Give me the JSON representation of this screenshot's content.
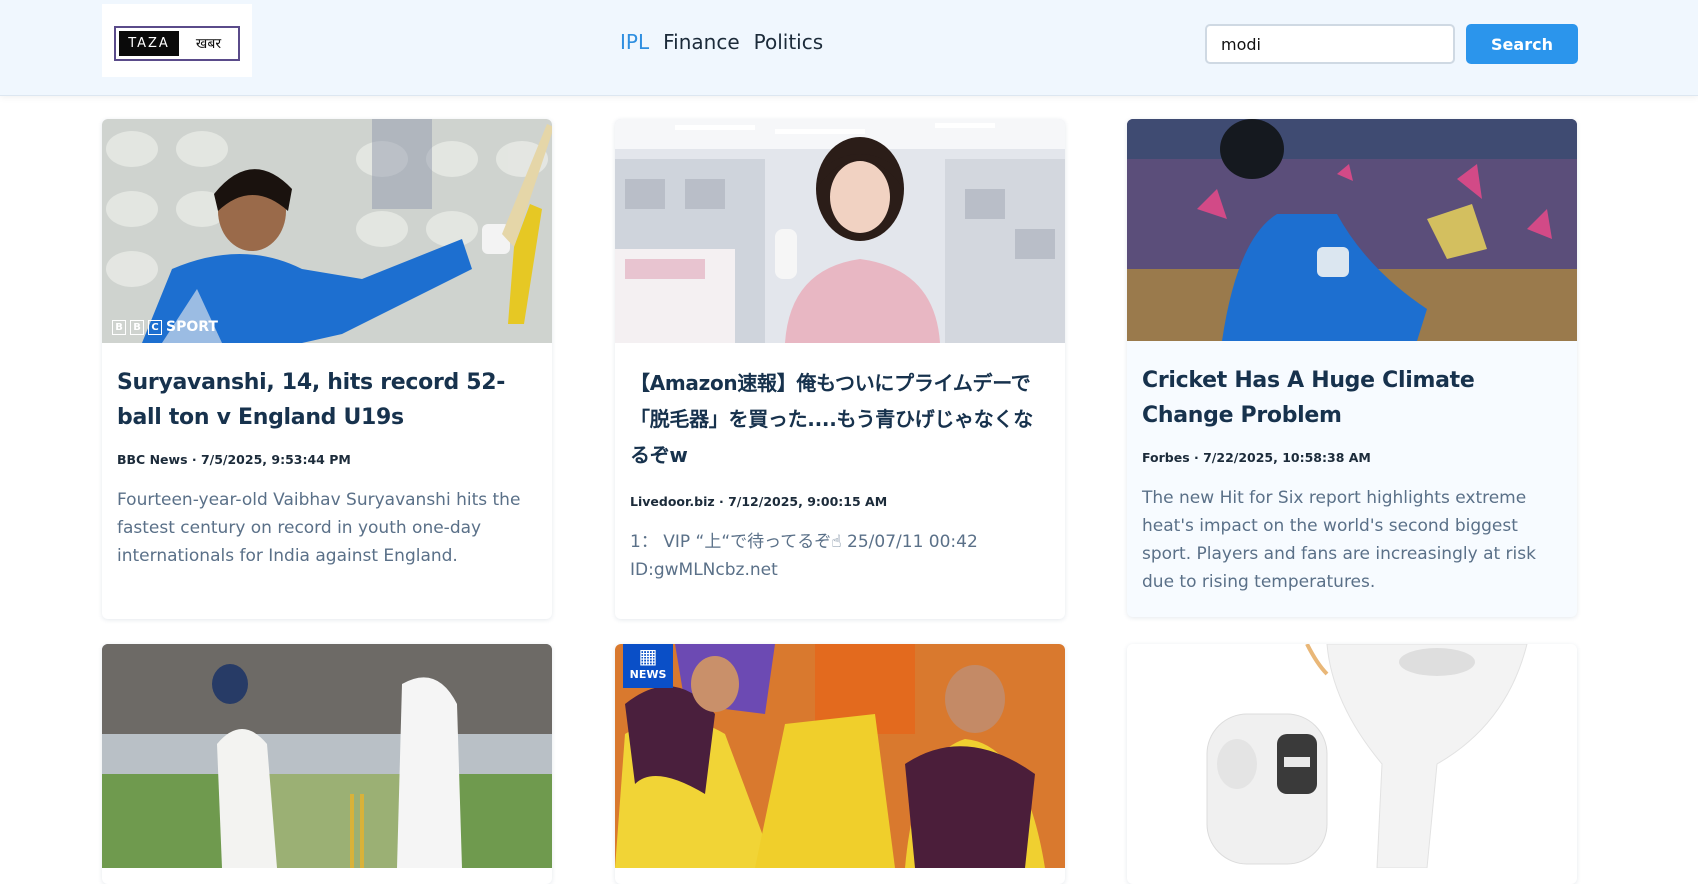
{
  "header": {
    "logo": {
      "left": "TAZA",
      "right": "खबर"
    },
    "nav": [
      {
        "label": "IPL",
        "active": true
      },
      {
        "label": "Finance",
        "active": false
      },
      {
        "label": "Politics",
        "active": false
      }
    ],
    "search": {
      "value": "modi",
      "button_label": "Search"
    }
  },
  "colors": {
    "accent": "#2b95ec",
    "active_nav": "#2f8fe0",
    "title": "#17324d",
    "description": "#5a7088",
    "header_bg": "#f0f7fe"
  },
  "articles": [
    {
      "title": "Suryavanshi, 14, hits record 52-ball ton v England U19s",
      "meta": "BBC News · 7/5/2025, 9:53:44 PM",
      "description": "Fourteen-year-old Vaibhav Suryavanshi hits the fastest century on record in youth one-day internationals for India against England.",
      "image_badge": "SPORT"
    },
    {
      "title": "【Amazon速報】俺もついにプライムデーで「脱毛器」を買った....もう青ひげじゃなくなるぞw",
      "meta": "Livedoor.biz · 7/12/2025, 9:00:15 AM",
      "description": "1： VIP “上“で待ってるぞ☝ 25/07/11 00:42 ID:gwMLNcbz.net"
    },
    {
      "title": "Cricket Has A Huge Climate Change Problem",
      "meta": "Forbes · 7/22/2025, 10:58:38 AM",
      "description": "The new Hit for Six report highlights extreme heat's impact on the world's second biggest sport. Players and fans are increasingly at risk due to rising temperatures."
    },
    {
      "title": "",
      "meta": "",
      "description": ""
    },
    {
      "title": "",
      "meta": "",
      "description": "",
      "image_badge": "NEWS"
    },
    {
      "title": "",
      "meta": "",
      "description": ""
    }
  ]
}
